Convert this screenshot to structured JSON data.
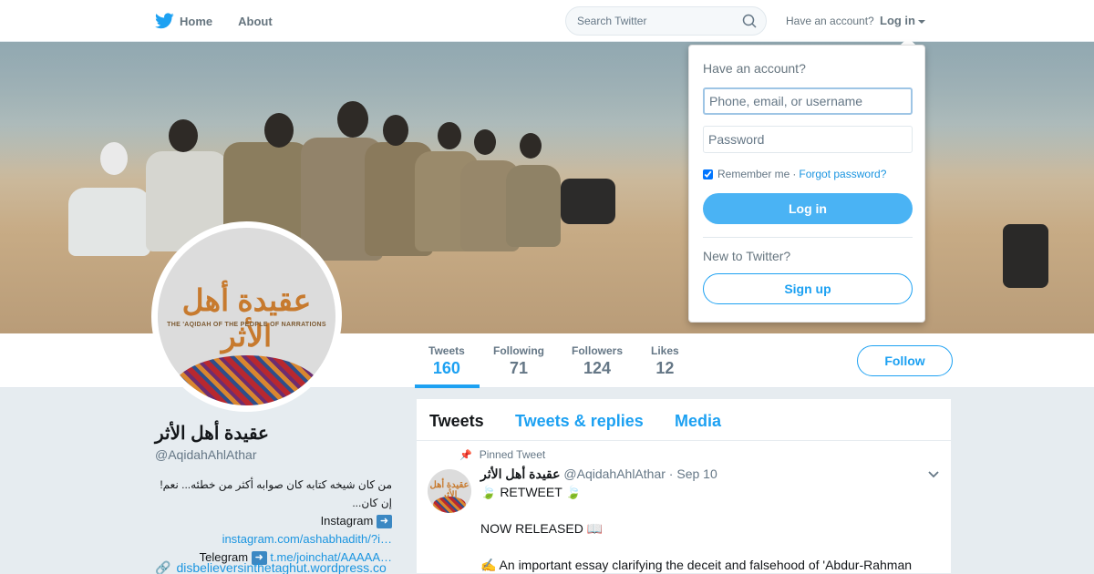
{
  "nav": {
    "home_label": "Home",
    "about_label": "About",
    "search_placeholder": "Search Twitter",
    "have_account": "Have an account?",
    "login_label": "Log in"
  },
  "profile": {
    "name": "عقيدة أهل الأثر",
    "handle": "@AqidahAhlAthar",
    "avatar_title": "عقيدة أهل الأثر",
    "avatar_subtitle": "THE 'AQIDAH OF THE PEOPLE OF NARRATIONS",
    "bio_arabic": "من كان شيخه كتابه كان صوابه أكثر من خطئه... نعم! إن كان...",
    "bio_instagram_label": "Instagram",
    "bio_instagram_link": "instagram.com/ashabhadith/?i…",
    "bio_telegram_label": "Telegram",
    "bio_telegram_link": "t.me/joinchat/AAAAA…",
    "website": "disbelieversinthetaghut.wordpress.co",
    "follow_label": "Follow"
  },
  "stats": [
    {
      "label": "Tweets",
      "value": "160"
    },
    {
      "label": "Following",
      "value": "71"
    },
    {
      "label": "Followers",
      "value": "124"
    },
    {
      "label": "Likes",
      "value": "12"
    }
  ],
  "timeline": {
    "tabs": [
      "Tweets",
      "Tweets & replies",
      "Media"
    ],
    "pinned_label": "Pinned Tweet",
    "tweet": {
      "name": "عقيدة أهل الأثر",
      "handle": "@AqidahAhlAthar",
      "date": "Sep 10",
      "lines": [
        "🍃 RETWEET 🍃",
        "",
        "NOW RELEASED 📖",
        "",
        "✍️ An important essay clarifying the deceit and falsehood of 'Abdur-Rahman"
      ]
    }
  },
  "login_dropdown": {
    "title": "Have an account?",
    "username_placeholder": "Phone, email, or username",
    "password_placeholder": "Password",
    "remember_me": "Remember me",
    "separator": "·",
    "forgot_password": "Forgot password?",
    "login_button": "Log in",
    "new_to_twitter": "New to Twitter?",
    "signup_button": "Sign up"
  },
  "colors": {
    "accent": "#1da1f2",
    "login_button": "#4ab3f4",
    "background": "#e6ecf0"
  }
}
